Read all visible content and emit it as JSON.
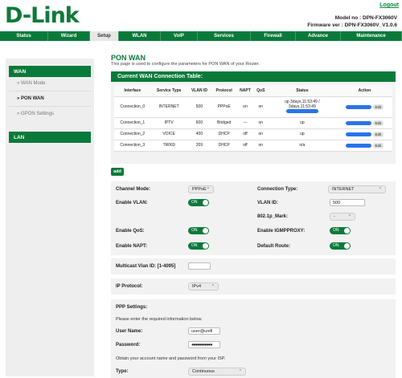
{
  "brand": {
    "logo": "D-Link",
    "logout": "Logout",
    "model": "Model no : DPN-FX3060V",
    "firmware": "Firmware ver : DPN-FX3060V_V1.0.6"
  },
  "nav": [
    "Status",
    "Wizard",
    "Setup",
    "WLAN",
    "VoIP",
    "Services",
    "Firewall",
    "Advance",
    "Maintenance"
  ],
  "nav_active": "Setup",
  "sidebar": {
    "wan_header": "WAN",
    "items": [
      "WAN Mode",
      "PON WAN",
      "GPON Settings"
    ],
    "lan_header": "LAN"
  },
  "page": {
    "title": "PON WAN",
    "description": "This page is used to configure the parameters for PON WAN of your Router."
  },
  "wan_table": {
    "title": "Current WAN Connection Table:",
    "columns": [
      "Interface",
      "Service Type",
      "VLAN ID",
      "Protocol",
      "NAPT",
      "QoS",
      "Status",
      "Action"
    ],
    "rows": [
      {
        "interface": "Connection_0",
        "service": "INTERNET",
        "vlan": "500",
        "protocol": "PPPoE",
        "napt": "on",
        "qos": "on",
        "status": "up 3days,11:53:49 / 3days,11:53:49",
        "action": "Edit"
      },
      {
        "interface": "Connection_1",
        "service": "IPTV",
        "vlan": "600",
        "protocol": "Bridged",
        "napt": "---",
        "qos": "on",
        "status": "up",
        "action": "Edit"
      },
      {
        "interface": "Connection_2",
        "service": "VOICE",
        "vlan": "400",
        "protocol": "DHCP",
        "napt": "off",
        "qos": "on",
        "status": "up",
        "action": "Edit"
      },
      {
        "interface": "Connection_3",
        "service": "TR069",
        "vlan": "209",
        "protocol": "DHCP",
        "napt": "off",
        "qos": "on",
        "status": "n/a",
        "action": "Edit"
      }
    ]
  },
  "add_label": "add",
  "form": {
    "channel_mode_label": "Channel Mode:",
    "channel_mode": "PPPoE",
    "connection_type_label": "Connection Type:",
    "connection_type": "INTERNET",
    "enable_vlan_label": "Enable VLAN:",
    "vlan_id_label": "VLAN ID:",
    "vlan_id": "500",
    "mark_label": "802.1p_Mark:",
    "mark": "-",
    "qos_label": "Enable QoS:",
    "igmp_label": "Enable IGMPPROXY:",
    "napt_label": "Enable NAPT:",
    "default_route_label": "Default Route:",
    "toggle_on": "ON",
    "multicast_label": "Multicast Vlan ID: [1-4095]",
    "multicast_value": "",
    "ip_protocol_label": "IP Protocol:",
    "ip_protocol": "IPv4",
    "ppp_title": "PPP Settings:",
    "ppp_info": "Please enter the required information below.",
    "username_label": "User Name:",
    "username": "user@unifi",
    "password_label": "Password:",
    "password": "●●●●●●●●●●●",
    "ppp_note": "Obtain your account name and password from your ISP.",
    "type_label": "Type:",
    "type": "Continuous"
  },
  "colors": {
    "brand_green": "#0a7a3a",
    "action_blue": "#2a74e8"
  }
}
